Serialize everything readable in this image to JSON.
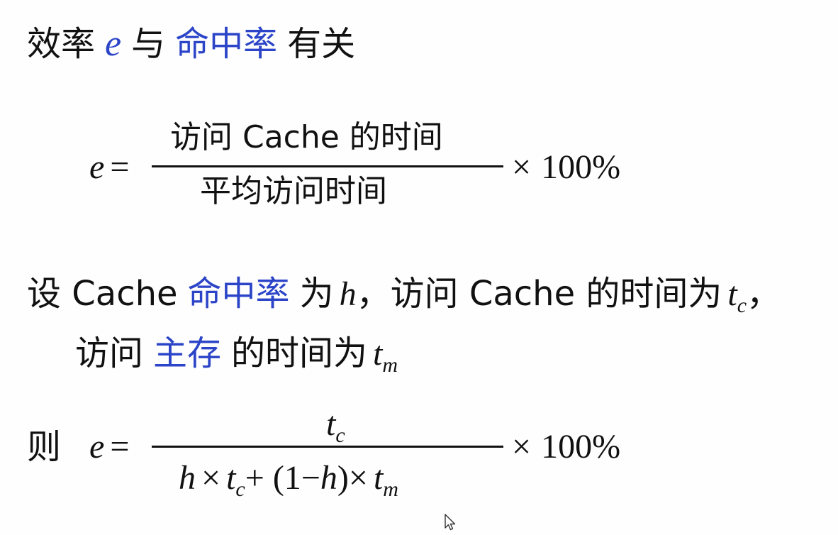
{
  "line1": {
    "prefix": "效率",
    "var_e": "e",
    "mid": "与",
    "term": "命中率",
    "suffix": "有关"
  },
  "formula1": {
    "lhs": "e",
    "equals": "=",
    "numerator": "访问 Cache 的时间",
    "denominator": "平均访问时间",
    "times": "×",
    "percent": "100%"
  },
  "line2": {
    "set": "设 Cache",
    "term_hit": "命中率",
    "as": "为",
    "var_h": "h",
    "comma_access": "，访问 Cache 的时间为",
    "var_t": "t",
    "sub_c": "c",
    "comma_end": "，"
  },
  "line3": {
    "access": "访问",
    "term_main": "主存",
    "time_as": "的时间为",
    "var_t": "t",
    "sub_m": "m"
  },
  "formula2": {
    "then": "则",
    "lhs": "e",
    "equals": "=",
    "num_t": "t",
    "num_sub": "c",
    "den_h": "h",
    "den_times1": "×",
    "den_t1": "t",
    "den_sub1": "c",
    "den_plus": "+ (1−",
    "den_h2": "h",
    "den_close": ")×",
    "den_t2": "t",
    "den_sub2": "m",
    "times": "×",
    "percent": "100%"
  },
  "colors": {
    "text": "#111111",
    "accent_blue": "#2b44c8",
    "background": "#fefefe"
  },
  "icons": {
    "cursor": "mouse-pointer-icon"
  }
}
